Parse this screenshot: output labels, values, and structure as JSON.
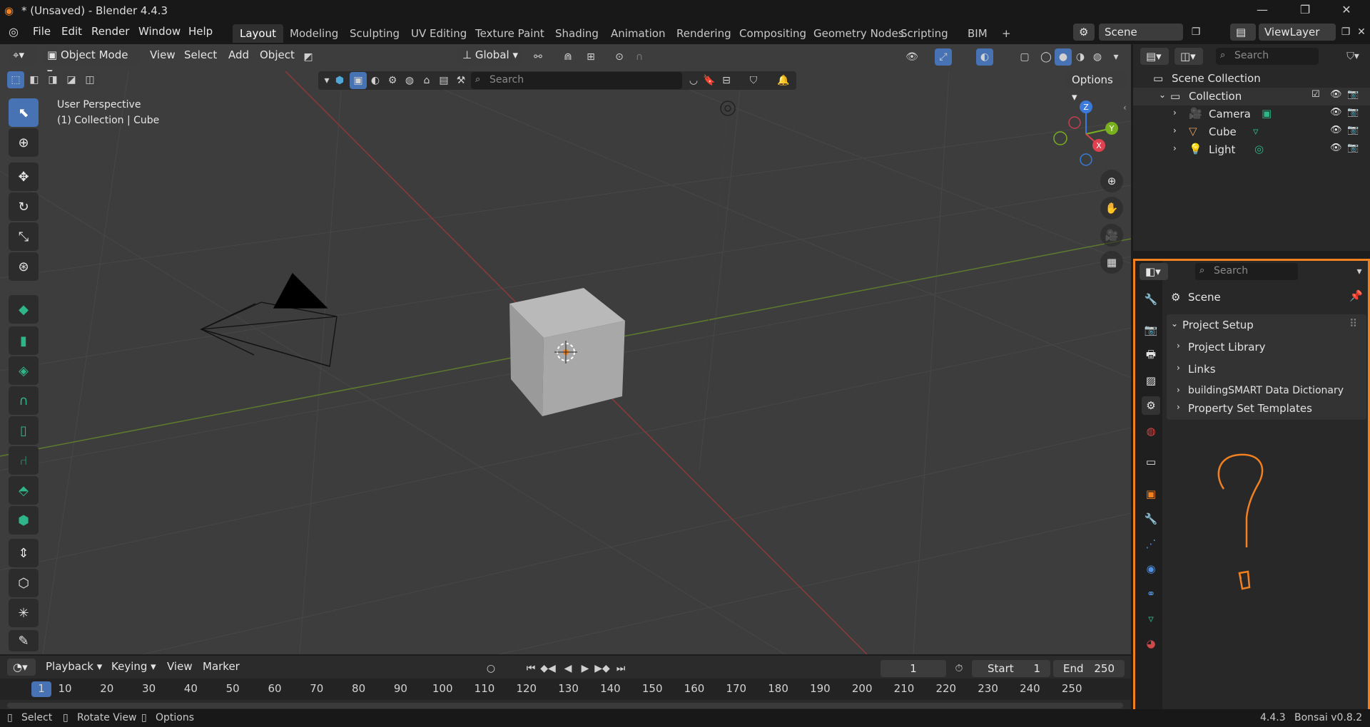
{
  "window": {
    "title": "* (Unsaved) - Blender 4.4.3",
    "minimize": "—",
    "restore": "❐",
    "close": "✕"
  },
  "menubar": {
    "menus": [
      "File",
      "Edit",
      "Render",
      "Window",
      "Help"
    ],
    "workspaces": [
      "Layout",
      "Modeling",
      "Sculpting",
      "UV Editing",
      "Texture Paint",
      "Shading",
      "Animation",
      "Rendering",
      "Compositing",
      "Geometry Nodes",
      "Scripting",
      "BIM"
    ],
    "active_workspace": "Layout",
    "add_workspace": "+",
    "scene_name": "Scene",
    "view_layer": "ViewLayer"
  },
  "viewport_header": {
    "mode": "Object Mode",
    "menus": [
      "View",
      "Select",
      "Add",
      "Object"
    ],
    "transform_orientation": "Global",
    "search_placeholder": "Search",
    "options_label": "Options"
  },
  "viewport": {
    "perspective_label": "User Perspective",
    "context_label": "(1) Collection | Cube",
    "gizmo": {
      "x": "X",
      "y": "Y",
      "z": "Z"
    }
  },
  "timeline": {
    "menus": [
      "Playback",
      "Keying",
      "View",
      "Marker"
    ],
    "current_frame": "1",
    "start_label": "Start",
    "start_value": "1",
    "end_label": "End",
    "end_value": "250",
    "ruler": [
      "1",
      "10",
      "20",
      "30",
      "40",
      "50",
      "60",
      "70",
      "80",
      "90",
      "100",
      "110",
      "120",
      "130",
      "140",
      "150",
      "160",
      "170",
      "180",
      "190",
      "200",
      "210",
      "220",
      "230",
      "240",
      "250"
    ]
  },
  "outliner": {
    "search_placeholder": "Search",
    "scene_collection": "Scene Collection",
    "collection": "Collection",
    "items": [
      {
        "name": "Camera",
        "icon": "camera-icon",
        "color": "#e8a060"
      },
      {
        "name": "Cube",
        "icon": "mesh-icon",
        "color": "#e8a060"
      },
      {
        "name": "Light",
        "icon": "light-icon",
        "color": "#e8a060"
      }
    ]
  },
  "properties": {
    "search_placeholder": "Search",
    "context": "Scene",
    "panel_title": "Project Setup",
    "subpanels": [
      "Project Library",
      "Links",
      "buildingSMART Data Dictionary",
      "Property Set Templates"
    ],
    "highlight_color": "#f08020"
  },
  "statusbar": {
    "items": [
      "Select",
      "Rotate View",
      "Options"
    ],
    "version": "4.4.3",
    "addon": "Bonsai v0.8.2"
  }
}
